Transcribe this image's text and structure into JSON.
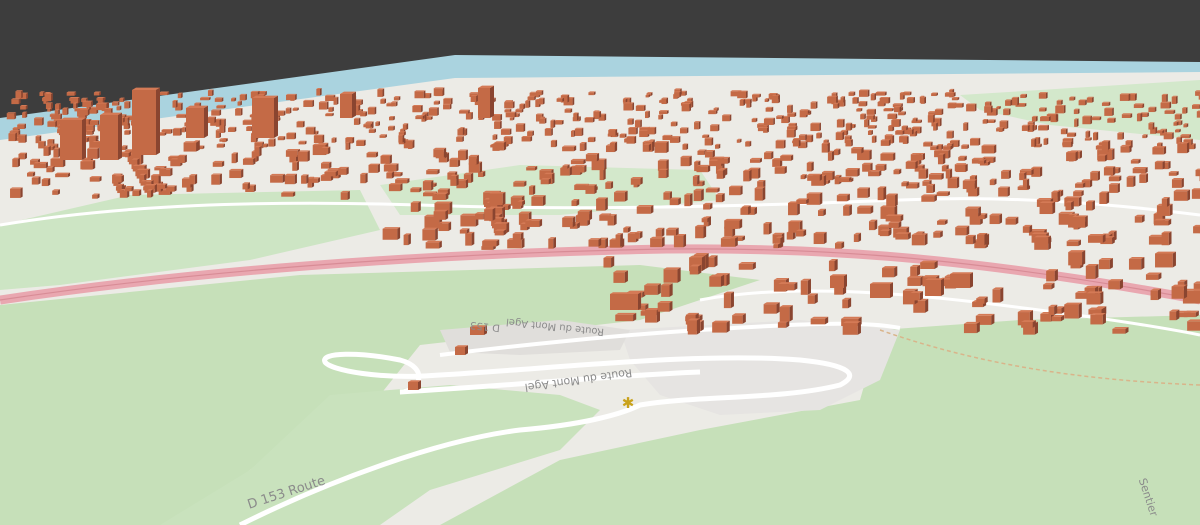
{
  "viewport": {
    "background_color": "#3d3d3d",
    "sea_color": "#aad3df",
    "land_color": "#f1efe9",
    "park_color": "#cfe6c7",
    "wood_color": "#c3dfb6",
    "building_color": "#c46a46",
    "building_top_color": "#d47a56",
    "building_shadow_color": "#8a4530",
    "main_road_color": "#e9a7b0",
    "minor_road_color": "#ffffff"
  },
  "map_labels": {
    "d153_bottom": "D 153 Route",
    "route_mont_agel": "Route du Mont Agel",
    "d153_mid": "D 153",
    "route_mont_agel_top": "Route du Mont Agel",
    "right_edge": "Sentier"
  },
  "poi": {
    "icon": "viewpoint-icon",
    "glyph": "✱",
    "color": "#c9a21b"
  }
}
